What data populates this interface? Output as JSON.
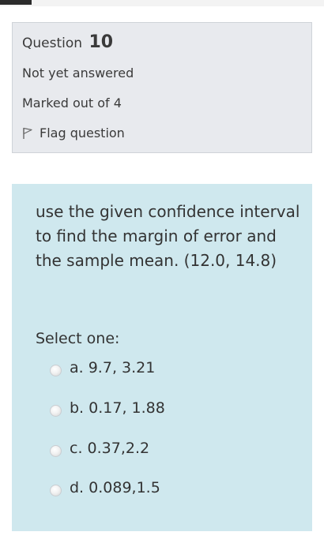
{
  "question_info": {
    "label": "Question",
    "number": "10",
    "status": "Not yet answered",
    "marks": "Marked out of 4",
    "flag_label": "Flag question"
  },
  "question": {
    "text": "use the given confidence interval to find the margin of error and the sample mean. (12.0, 14.8)",
    "prompt": "Select one:",
    "options": [
      {
        "label": "a. 9.7, 3.21"
      },
      {
        "label": "b. 0.17, 1.88"
      },
      {
        "label": "c. 0.37,2.2"
      },
      {
        "label": "d. 0.089,1.5"
      }
    ]
  },
  "colors": {
    "info_bg": "#e8eaee",
    "question_bg": "#cfe8ee",
    "text": "#333333"
  },
  "icons": {
    "flag": "flag-icon",
    "radio": "radio-unchecked"
  }
}
